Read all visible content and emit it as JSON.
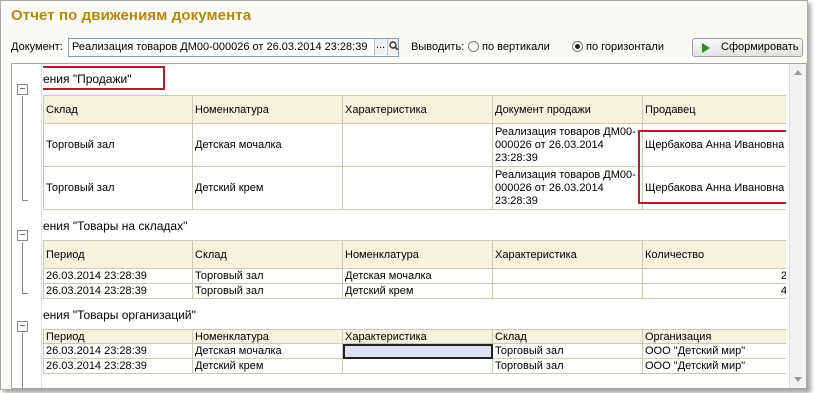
{
  "window": {
    "title": "Отчет по движениям документа"
  },
  "toolbar": {
    "doc_label": "Документ:",
    "doc_value": "Реализация товаров ДМ00-000026 от 26.03.2014 23:28:39",
    "dots": "...",
    "output_label": "Выводить:",
    "radio_vertical": "по вертикали",
    "radio_horizontal": "по горизонтали",
    "selected_output": "по горизонтали",
    "run_label": "Сформировать"
  },
  "sections": {
    "sales": {
      "title": "ения \"Продажи\"",
      "headers": [
        "Склад",
        "Номенклатура",
        "Характеристика",
        "Документ продажи",
        "Продавец"
      ],
      "rows": [
        [
          "Торговый зал",
          "Детская мочалка",
          "",
          "Реализация товаров ДМ00-000026 от 26.03.2014 23:28:39",
          "Щербакова Анна Ивановна"
        ],
        [
          "Торговый зал",
          "Детский крем",
          "",
          "Реализация товаров ДМ00-000026 от 26.03.2014 23:28:39",
          "Щербакова Анна Ивановна"
        ]
      ]
    },
    "stock": {
      "title": "ения \"Товары на складах\"",
      "headers": [
        "Период",
        "Склад",
        "Номенклатура",
        "Характеристика",
        "Количество"
      ],
      "rows": [
        [
          "26.03.2014 23:28:39",
          "Торговый зал",
          "Детская мочалка",
          "",
          "2"
        ],
        [
          "26.03.2014 23:28:39",
          "Торговый зал",
          "Детский крем",
          "",
          "4"
        ]
      ]
    },
    "org": {
      "title": "ения \"Товары организаций\"",
      "headers": [
        "Период",
        "Номенклатура",
        "Характеристика",
        "Склад",
        "Организация"
      ],
      "rows": [
        [
          "26.03.2014 23:28:39",
          "Детская мочалка",
          "",
          "Торговый зал",
          "ООО \"Детский мир\""
        ],
        [
          "26.03.2014 23:28:39",
          "Детский крем",
          "",
          "Торговый зал",
          "ООО \"Детский мир\""
        ]
      ]
    }
  },
  "colors": {
    "title": "#b8860b",
    "header_bg": "#f5f3dc",
    "highlight": "#b0202a",
    "selected_cell": "#dde1ef"
  }
}
